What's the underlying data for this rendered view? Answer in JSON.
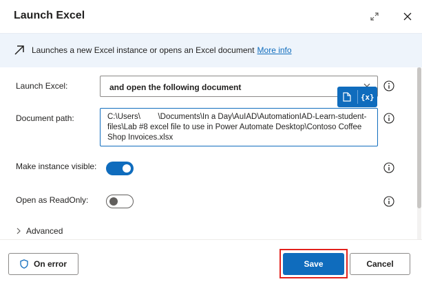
{
  "dialog": {
    "title": "Launch Excel"
  },
  "banner": {
    "text": "Launches a new Excel instance or opens an Excel document",
    "link": "More info"
  },
  "fields": {
    "launch_excel": {
      "label": "Launch Excel:",
      "value": "and open the following document"
    },
    "document_path": {
      "label": "Document path:",
      "value": "C:\\Users\\        \\Documents\\In a Day\\AuIAD\\AutomationIAD-Learn-student-files\\Lab #8 excel file to use in Power Automate Desktop\\Contoso Coffee Shop Invoices.xlsx"
    },
    "make_visible": {
      "label": "Make instance visible:",
      "state": "on"
    },
    "read_only": {
      "label": "Open as ReadOnly:",
      "state": "off"
    }
  },
  "variable_picker": {
    "label": "{x}"
  },
  "advanced": {
    "label": "Advanced"
  },
  "footer": {
    "on_error": "On error",
    "save": "Save",
    "cancel": "Cancel"
  },
  "icons": {
    "expand": "expand-icon",
    "close": "close-icon",
    "banner": "arrow-up-right-icon",
    "info": "info-icon",
    "file": "file-icon",
    "shield": "shield-icon",
    "chevron": "chevron-down-icon"
  },
  "colors": {
    "accent": "#0f6cbd",
    "banner_bg": "#eef4fb",
    "highlight": "#e3201b"
  }
}
